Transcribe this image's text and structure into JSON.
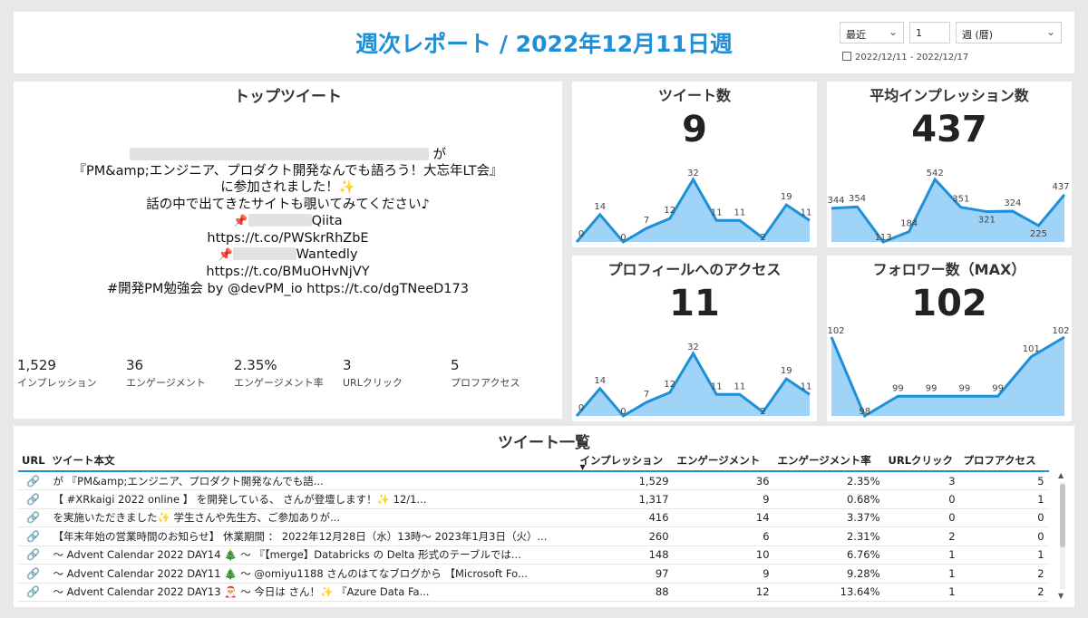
{
  "header": {
    "title": "週次レポート / 2022年12月11日週",
    "filter_period_type": "最近",
    "filter_count": "1",
    "filter_unit": "週 (暦)",
    "date_range": "2022/12/11 - 2022/12/17"
  },
  "top_tweet": {
    "title": "トップツイート",
    "lines": [
      "が",
      "『PM&amp;エンジニア、プロダクト開発なんでも語ろう！大忘年LT会』",
      "に参加されました！✨",
      "話の中で出てきたサイトも覗いてみてください♪",
      "Qiita",
      "https://t.co/PWSkrRhZbE",
      "Wantedly",
      "https://t.co/BMuOHvNjVY",
      "#開発PM勉強会 by @devPM_io https://t.co/dgTNeeD173"
    ],
    "metrics": [
      {
        "value": "1,529",
        "label": "インプレッション"
      },
      {
        "value": "36",
        "label": "エンゲージメント"
      },
      {
        "value": "2.35%",
        "label": "エンゲージメント率"
      },
      {
        "value": "3",
        "label": "URLクリック"
      },
      {
        "value": "5",
        "label": "プロフアクセス"
      }
    ]
  },
  "kpis": {
    "tweets": {
      "title": "ツイート数",
      "value": "9"
    },
    "impressions": {
      "title": "平均インプレッション数",
      "value": "437"
    },
    "profile": {
      "title": "プロフィールへのアクセス",
      "value": "11"
    },
    "followers": {
      "title": "フォロワー数（MAX）",
      "value": "102"
    }
  },
  "chart_data": [
    {
      "type": "area",
      "name": "ツイート数",
      "values": [
        0,
        14,
        0,
        7,
        12,
        32,
        11,
        11,
        2,
        19,
        11
      ],
      "ylim": [
        0,
        32
      ]
    },
    {
      "type": "area",
      "name": "平均インプレッション数",
      "values": [
        344,
        354,
        113,
        184,
        542,
        351,
        321,
        324,
        225,
        437
      ],
      "ylim": [
        113,
        542
      ]
    },
    {
      "type": "area",
      "name": "プロフィールへのアクセス",
      "values": [
        0,
        14,
        0,
        7,
        12,
        32,
        11,
        11,
        2,
        19,
        11
      ],
      "ylim": [
        0,
        32
      ]
    },
    {
      "type": "area",
      "name": "フォロワー数（MAX）",
      "values": [
        102,
        98,
        99,
        99,
        99,
        99,
        101,
        102
      ],
      "ylim": [
        98,
        102
      ]
    }
  ],
  "table": {
    "title": "ツイート一覧",
    "columns": [
      "URL",
      "ツイート本文",
      "インプレッション",
      "エンゲージメント",
      "エンゲージメント率",
      "URLクリック",
      "プロフアクセス"
    ],
    "rows": [
      {
        "text": "が 『PM&amp;エンジニア、プロダクト開発なんでも語...",
        "imp": "1,529",
        "eng": "36",
        "rate": "2.35%",
        "url": "3",
        "prof": "5"
      },
      {
        "text": "【 #XRkaigi 2022 online 】 を開発している、 さんが登壇します！✨ 12/1...",
        "imp": "1,317",
        "eng": "9",
        "rate": "0.68%",
        "url": "0",
        "prof": "1"
      },
      {
        "text": "を実施いただきました✨ 学生さんや先生方、ご参加ありが...",
        "imp": "416",
        "eng": "14",
        "rate": "3.37%",
        "url": "0",
        "prof": "0"
      },
      {
        "text": "【年末年始の営業時間のお知らせ】 休業期間 ： 2022年12月28日（水）13時～ 2023年1月3日（火）...",
        "imp": "260",
        "eng": "6",
        "rate": "2.31%",
        "url": "2",
        "prof": "0"
      },
      {
        "text": "～ Advent Calendar 2022 DAY14 🎄 ～ 『【merge】Databricks の Delta 形式のテーブルでは...",
        "imp": "148",
        "eng": "10",
        "rate": "6.76%",
        "url": "1",
        "prof": "1"
      },
      {
        "text": "～ Advent Calendar 2022 DAY11 🎄 ～ @omiyu1188 さんのはてなブログから 【Microsoft Fo...",
        "imp": "97",
        "eng": "9",
        "rate": "9.28%",
        "url": "1",
        "prof": "2"
      },
      {
        "text": "～ Advent Calendar 2022 DAY13 🎅 ～ 今日は さん！✨ 『Azure Data Fa...",
        "imp": "88",
        "eng": "12",
        "rate": "13.64%",
        "url": "1",
        "prof": "2"
      }
    ]
  },
  "colors": {
    "accent": "#1f8fd8",
    "area_fill": "#9fd3f7",
    "area_line": "#1f8fd8"
  }
}
